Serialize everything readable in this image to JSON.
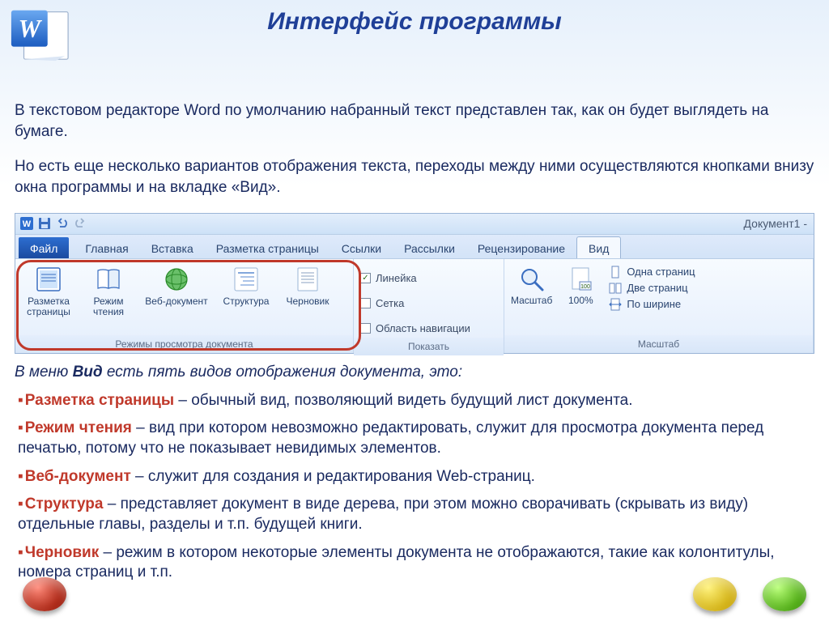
{
  "title": "Интерфейс программы",
  "paragraphs": {
    "p1": "В текстовом редакторе Word по умолчанию набранный текст представлен так, как он будет выглядеть на бумаге.",
    "p2": "Но есть еще несколько вариантов отображения текста, переходы между ними осуществляются кнопками внизу окна программы и на вкладке «Вид»."
  },
  "qat": {
    "document_name": "Документ1 -"
  },
  "tabs": {
    "file": "Файл",
    "home": "Главная",
    "insert": "Вставка",
    "layout": "Разметка страницы",
    "links": "Ссылки",
    "mail": "Рассылки",
    "review": "Рецензирование",
    "view": "Вид"
  },
  "view_modes": {
    "print": "Разметка\nстраницы",
    "reading": "Режим\nчтения",
    "web": "Веб-документ",
    "outline": "Структура",
    "draft": "Черновик",
    "group_label": "Режимы просмотра документа"
  },
  "show_group": {
    "ruler": "Линейка",
    "grid": "Сетка",
    "nav": "Область навигации",
    "group_label": "Показать",
    "ruler_checked": "✓"
  },
  "zoom_group": {
    "zoom": "Масштаб",
    "percent": "100%",
    "group_label": "Масштаб",
    "one_page": "Одна страниц",
    "two_pages": "Две страниц",
    "fit_width": "По ширине"
  },
  "subheading_prefix": "В меню ",
  "subheading_bold": "Вид",
  "subheading_suffix": " есть пять видов отображения документа, это:",
  "modes_list": [
    {
      "name": "Разметка страницы",
      "desc": " – обычный вид, позволяющий видеть будущий лист документа."
    },
    {
      "name": "Режим чтения",
      "desc": " – вид при котором невозможно редактировать, служит для просмотра документа перед печатью, потому что не показывает невидимых элементов."
    },
    {
      "name": "Веб-документ",
      "desc": " – служит для создания и редактирования Web-страниц."
    },
    {
      "name": "Структура",
      "desc": " – представляет документ в виде дерева, при этом можно сворачивать (скрывать из виду) отдельные главы, разделы и т.п. будущей книги."
    },
    {
      "name": "Черновик",
      "desc": " – режим в котором некоторые элементы документа не отображаются, такие как колонтитулы, номера страниц и т.п."
    }
  ]
}
